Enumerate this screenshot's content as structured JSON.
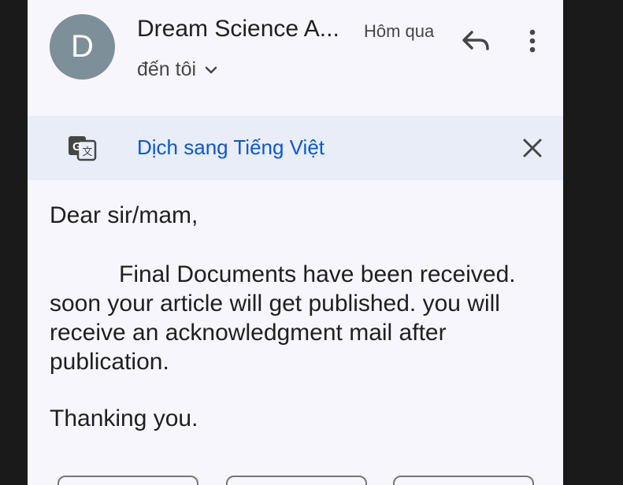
{
  "email": {
    "avatar_letter": "D",
    "avatar_color": "#7d8f99",
    "sender": "Dream Science A...",
    "time": "Hôm qua",
    "recipient": "đến tôi",
    "reply_icon": "reply-icon",
    "more_icon": "more-vert-icon"
  },
  "translate_banner": {
    "icon": "translate-icon",
    "link_label": "Dịch sang Tiếng Việt",
    "close_icon": "close-icon",
    "link_color": "#0b57d0",
    "background": "#e8edf7"
  },
  "body": {
    "greeting": "Dear sir/mam,",
    "paragraph_first_line": "Final Documents have been received.",
    "paragraph_line_2": "soon your article will get published. you will",
    "paragraph_line_3": "receive an acknowledgment mail after",
    "paragraph_line_4": "publication.",
    "closing": "Thanking you."
  },
  "colors": {
    "page_background": "#f7f6fc",
    "side_bars": "#1a1a1a"
  }
}
